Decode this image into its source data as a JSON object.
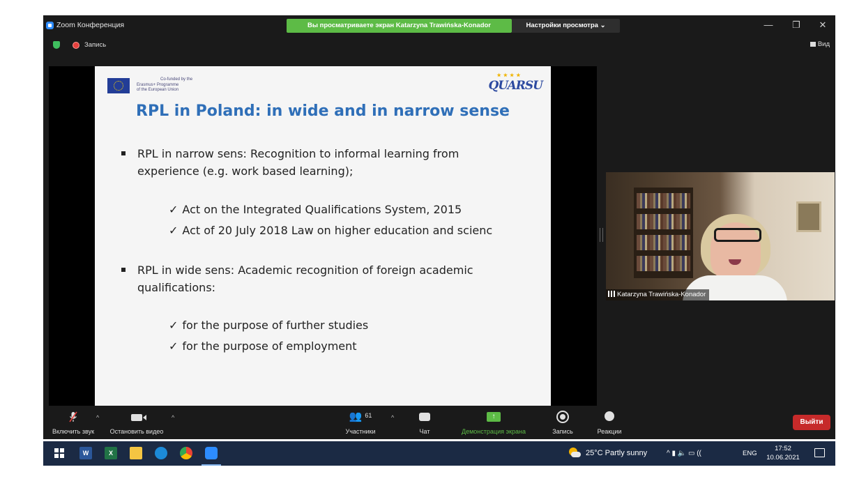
{
  "window": {
    "app_title": "Zoom Конференция",
    "share_banner": "Вы просматриваете экран Katarzyna Trawińska-Konador",
    "view_options": "Настройки просмотра ⌄",
    "minimize": "—",
    "restore": "❐",
    "close": "✕"
  },
  "status_bar": {
    "recording_label": "Запись",
    "view_label": "Вид"
  },
  "slide": {
    "eu_text": [
      "Co-funded by the",
      "Erasmus+ Programme",
      "of the European Union"
    ],
    "logo_text": "QUARSU",
    "logo_stars": "★★★★",
    "title": "RPL in Poland: in wide and in narrow sense",
    "bullets": [
      "RPL in narrow sens: Recognition to informal learning from experience (e.g. work based learning);",
      "RPL in wide sens: Academic recognition of foreign academic qualifications:"
    ],
    "checks_1": [
      "Act on the Integrated Qualifications System, 2015",
      "Act of 20 July 2018 Law on higher education and scienc"
    ],
    "checks_2": [
      "for the purpose of further studies",
      "for the purpose of employment"
    ],
    "check_mark": "✓"
  },
  "participant": {
    "name": "Katarzyna Trawińska-Konador"
  },
  "toolbar": {
    "unmute_label": "Включить звук",
    "stop_video_label": "Остановить видео",
    "participants_label": "Участники",
    "participants_count": "61",
    "chat_label": "Чат",
    "share_label": "Демонстрация экрана",
    "record_label": "Запись",
    "reactions_label": "Реакции",
    "leave_label": "Выйти",
    "caret": "^",
    "people_glyph": "👥",
    "share_glyph": "↑"
  },
  "taskbar": {
    "word_label": "W",
    "excel_label": "X",
    "weather": "25°C  Partly sunny",
    "tray_icons": "^  ▮  🔈  ▭  ((",
    "language": "ENG",
    "time": "17:52",
    "date": "10.06.2021"
  }
}
